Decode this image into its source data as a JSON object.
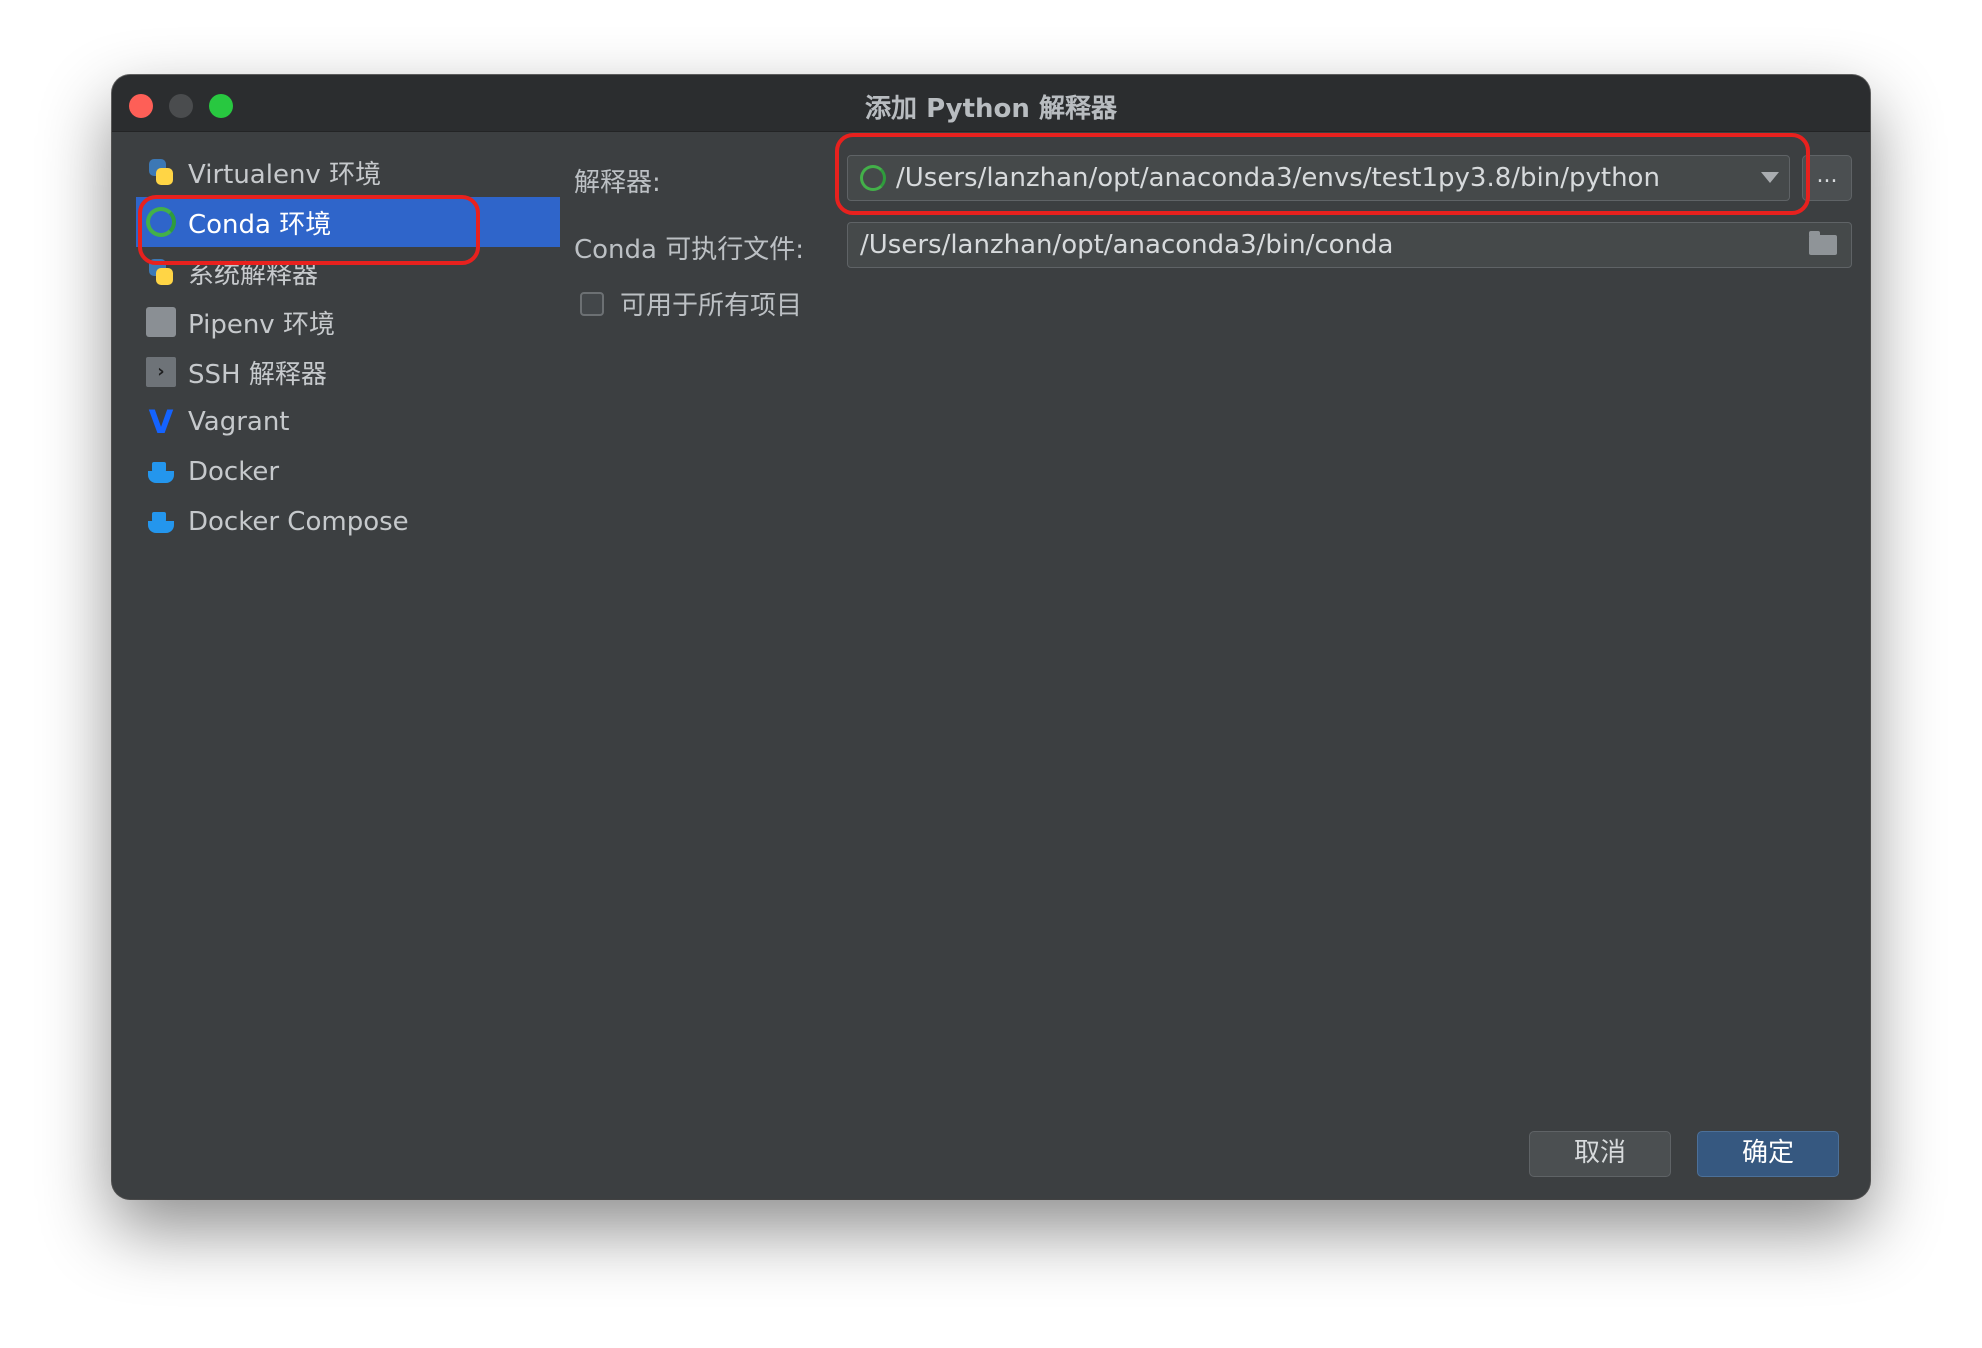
{
  "window": {
    "title": "添加 Python 解释器"
  },
  "sidebar": {
    "items": [
      {
        "label": "Virtualenv 环境",
        "icon": "python-virtualenv-icon",
        "selected": false
      },
      {
        "label": "Conda 环境",
        "icon": "conda-icon",
        "selected": true
      },
      {
        "label": "系统解释器",
        "icon": "python-icon",
        "selected": false
      },
      {
        "label": "Pipenv 环境",
        "icon": "pipenv-icon",
        "selected": false
      },
      {
        "label": "SSH 解释器",
        "icon": "ssh-icon",
        "selected": false
      },
      {
        "label": "Vagrant",
        "icon": "vagrant-icon",
        "selected": false
      },
      {
        "label": "Docker",
        "icon": "docker-icon",
        "selected": false
      },
      {
        "label": "Docker Compose",
        "icon": "docker-compose-icon",
        "selected": false
      }
    ]
  },
  "form": {
    "interpreter_label": "解释器:",
    "interpreter_value": "/Users/lanzhan/opt/anaconda3/envs/test1py3.8/bin/python",
    "browse_label": "...",
    "conda_exec_label": "Conda 可执行文件:",
    "conda_exec_value": "/Users/lanzhan/opt/anaconda3/bin/conda",
    "all_projects_label": "可用于所有项目",
    "all_projects_checked": false
  },
  "buttons": {
    "cancel": "取消",
    "ok": "确定"
  },
  "colors": {
    "window_bg": "#3c3f41",
    "selection": "#2f65ca",
    "highlight_annotation": "#e8211e",
    "ok_button": "#365880"
  }
}
